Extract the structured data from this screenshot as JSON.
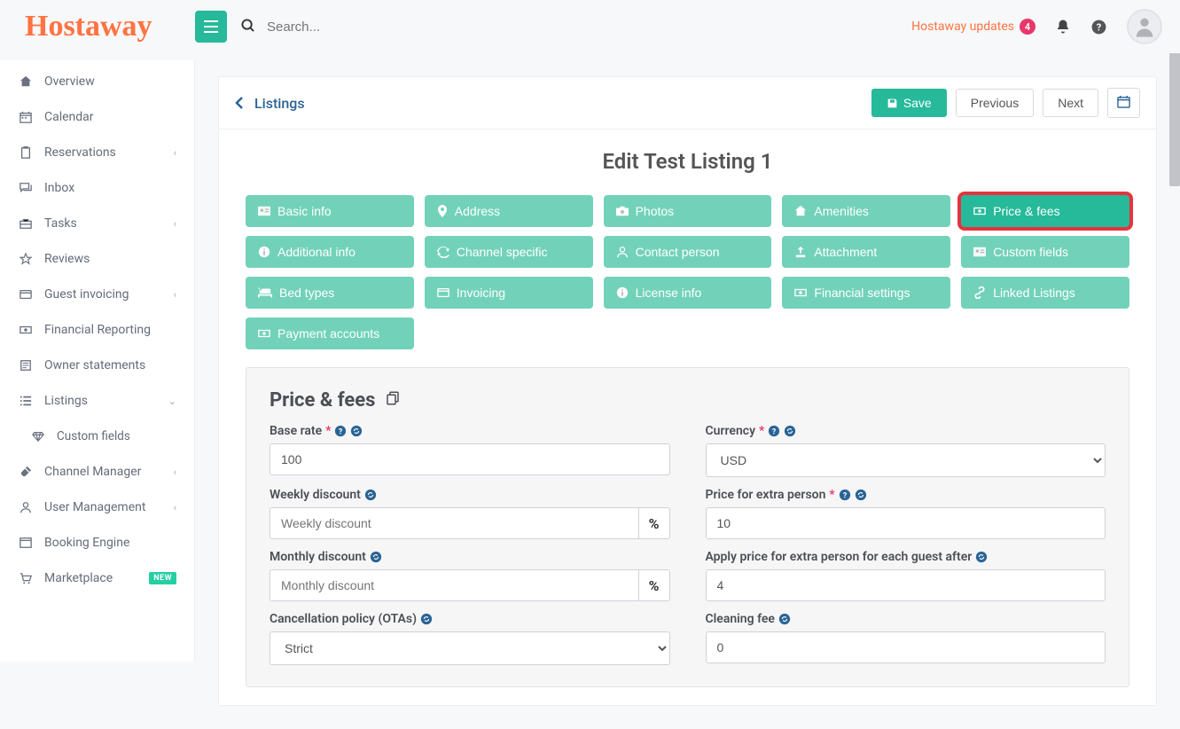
{
  "header": {
    "logo_text": "Hostaway",
    "search_placeholder": "Search...",
    "updates_text": "Hostaway updates",
    "updates_count": "4"
  },
  "sidebar": {
    "items": [
      {
        "icon": "home",
        "label": "Overview",
        "chev": false
      },
      {
        "icon": "calendar",
        "label": "Calendar",
        "chev": false
      },
      {
        "icon": "clipboard",
        "label": "Reservations",
        "chev": true
      },
      {
        "icon": "comments",
        "label": "Inbox",
        "chev": false
      },
      {
        "icon": "briefcase",
        "label": "Tasks",
        "chev": true
      },
      {
        "icon": "star",
        "label": "Reviews",
        "chev": false
      },
      {
        "icon": "card",
        "label": "Guest invoicing",
        "chev": true
      },
      {
        "icon": "money",
        "label": "Financial Reporting",
        "chev": false
      },
      {
        "icon": "doc",
        "label": "Owner statements",
        "chev": false
      },
      {
        "icon": "list",
        "label": "Listings",
        "chev": true,
        "expanded": true
      },
      {
        "icon": "diamond",
        "label": "Custom fields",
        "chev": false,
        "sub": true
      },
      {
        "icon": "plug",
        "label": "Channel Manager",
        "chev": true
      },
      {
        "icon": "user",
        "label": "User Management",
        "chev": true
      },
      {
        "icon": "window",
        "label": "Booking Engine",
        "chev": false
      },
      {
        "icon": "cart",
        "label": "Marketplace",
        "chev": false,
        "new": true
      }
    ]
  },
  "panel": {
    "back_label": "Listings",
    "save_label": "Save",
    "prev_label": "Previous",
    "next_label": "Next",
    "page_title": "Edit Test Listing 1"
  },
  "tabs": [
    {
      "icon": "id",
      "label": "Basic info"
    },
    {
      "icon": "pin",
      "label": "Address"
    },
    {
      "icon": "camera",
      "label": "Photos"
    },
    {
      "icon": "home",
      "label": "Amenities"
    },
    {
      "icon": "money",
      "label": "Price & fees",
      "active": true,
      "highlighted": true
    },
    {
      "icon": "info",
      "label": "Additional info"
    },
    {
      "icon": "sync",
      "label": "Channel specific"
    },
    {
      "icon": "user",
      "label": "Contact person"
    },
    {
      "icon": "upload",
      "label": "Attachment"
    },
    {
      "icon": "id",
      "label": "Custom fields"
    },
    {
      "icon": "bed",
      "label": "Bed types"
    },
    {
      "icon": "card",
      "label": "Invoicing"
    },
    {
      "icon": "info",
      "label": "License info"
    },
    {
      "icon": "money",
      "label": "Financial settings"
    },
    {
      "icon": "link",
      "label": "Linked Listings"
    },
    {
      "icon": "money",
      "label": "Payment accounts"
    }
  ],
  "section": {
    "title": "Price & fees",
    "fields": {
      "base_rate": {
        "label": "Base rate",
        "required": true,
        "help": true,
        "sync": true,
        "value": "100"
      },
      "currency": {
        "label": "Currency",
        "required": true,
        "help": true,
        "sync": true,
        "value": "USD"
      },
      "weekly_discount": {
        "label": "Weekly discount",
        "sync": true,
        "placeholder": "Weekly discount",
        "addon": "%"
      },
      "price_extra_person": {
        "label": "Price for extra person",
        "required": true,
        "help": true,
        "sync": true,
        "value": "10"
      },
      "monthly_discount": {
        "label": "Monthly discount",
        "sync": true,
        "placeholder": "Monthly discount",
        "addon": "%"
      },
      "apply_extra_after": {
        "label": "Apply price for extra person for each guest after",
        "sync": true,
        "value": "4"
      },
      "cancellation": {
        "label": "Cancellation policy (OTAs)",
        "sync": true,
        "value": "Strict"
      },
      "cleaning_fee": {
        "label": "Cleaning fee",
        "sync": true,
        "value": "0"
      }
    }
  }
}
